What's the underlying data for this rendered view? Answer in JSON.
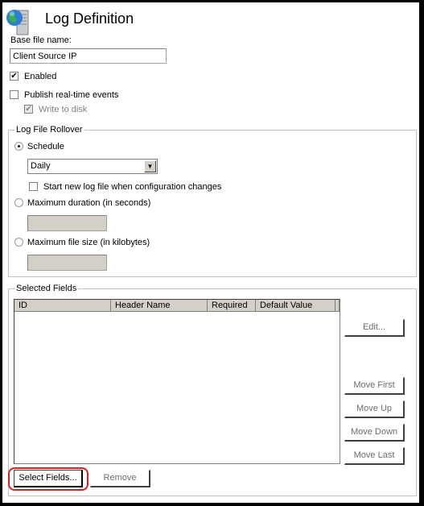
{
  "header": {
    "title": "Log Definition",
    "icon": "globe-server-icon"
  },
  "base_file": {
    "label": "Base file name:",
    "value": "Client Source IP"
  },
  "enabled": {
    "label": "Enabled",
    "checked": true
  },
  "publish": {
    "label": "Publish real-time events",
    "checked": false
  },
  "write_to_disk": {
    "label": "Write to disk",
    "checked": true,
    "disabled": true
  },
  "rollover": {
    "title": "Log File Rollover",
    "schedule": {
      "label": "Schedule",
      "selected": true,
      "value": "Daily"
    },
    "start_new": {
      "label": "Start new log file when configuration changes",
      "checked": false
    },
    "max_duration": {
      "label": "Maximum duration (in seconds)",
      "selected": false,
      "value": ""
    },
    "max_size": {
      "label": "Maximum file size (in kilobytes)",
      "selected": false,
      "value": ""
    }
  },
  "selected_fields": {
    "title": "Selected Fields",
    "columns": [
      "ID",
      "Header Name",
      "Required",
      "Default Value"
    ],
    "rows": [],
    "buttons": {
      "edit": "Edit...",
      "move_first": "Move First",
      "move_up": "Move Up",
      "move_down": "Move Down",
      "move_last": "Move Last",
      "select_fields": "Select Fields...",
      "remove": "Remove"
    }
  },
  "colors": {
    "highlight": "#e0201f",
    "disabled_bg": "#d4d0c8"
  }
}
